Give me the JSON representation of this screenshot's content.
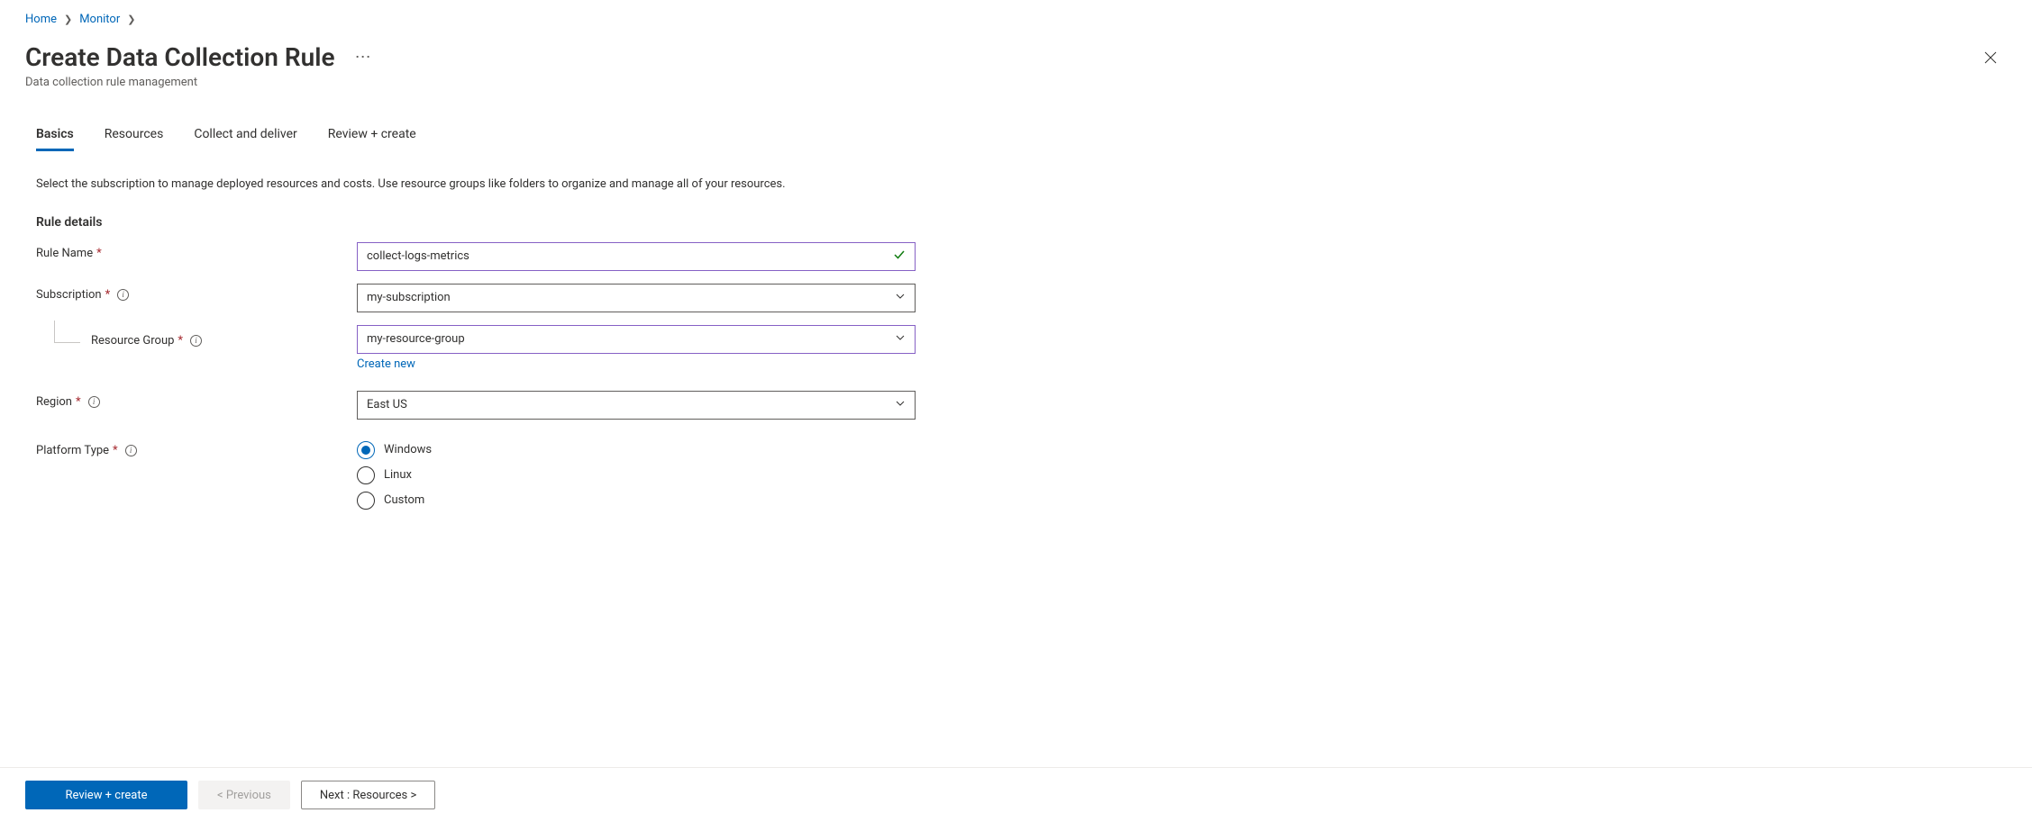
{
  "breadcrumb": {
    "items": [
      "Home",
      "Monitor"
    ]
  },
  "header": {
    "title": "Create Data Collection Rule",
    "subtitle": "Data collection rule management"
  },
  "tabs": [
    {
      "label": "Basics",
      "active": true
    },
    {
      "label": "Resources",
      "active": false
    },
    {
      "label": "Collect and deliver",
      "active": false
    },
    {
      "label": "Review + create",
      "active": false
    }
  ],
  "description": "Select the subscription to manage deployed resources and costs. Use resource groups like folders to organize and manage all of your resources.",
  "section": {
    "title": "Rule details"
  },
  "fields": {
    "ruleName": {
      "label": "Rule Name",
      "value": "collect-logs-metrics"
    },
    "subscription": {
      "label": "Subscription",
      "value": "my-subscription"
    },
    "resourceGroup": {
      "label": "Resource Group",
      "value": "my-resource-group",
      "createNew": "Create new"
    },
    "region": {
      "label": "Region",
      "value": "East US"
    },
    "platformType": {
      "label": "Platform Type",
      "options": [
        {
          "label": "Windows",
          "selected": true
        },
        {
          "label": "Linux",
          "selected": false
        },
        {
          "label": "Custom",
          "selected": false
        }
      ]
    }
  },
  "footer": {
    "review": "Review + create",
    "previous": "< Previous",
    "next": "Next : Resources >"
  }
}
